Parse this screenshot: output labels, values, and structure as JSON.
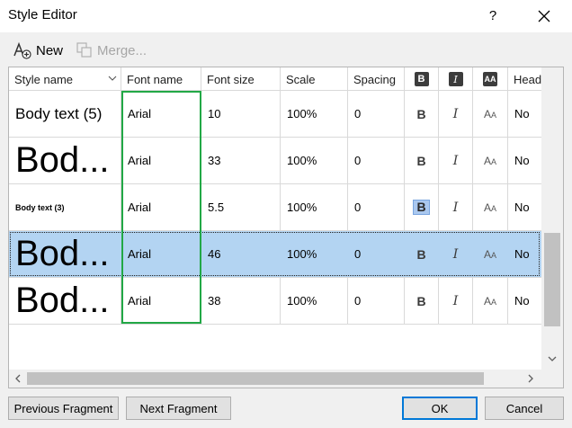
{
  "window": {
    "title": "Style Editor",
    "help_label": "?"
  },
  "toolbar": {
    "new_label": "New",
    "merge_label": "Merge..."
  },
  "grid": {
    "columns": {
      "style_name": "Style name",
      "font_name": "Font name",
      "font_size": "Font size",
      "scale": "Scale",
      "spacing": "Spacing",
      "heading": "Headi"
    },
    "header_icons": {
      "bold": "B",
      "italic": "I",
      "caps": "AA"
    },
    "glyphs": {
      "bold": "B",
      "italic": "I",
      "caps_big": "A",
      "caps_small": "A"
    },
    "rows": [
      {
        "style_name": "Body text (5)",
        "font_name": "Arial",
        "font_size": "10",
        "scale": "100%",
        "spacing": "0",
        "heading": "No",
        "bold_active": false,
        "selected": false
      },
      {
        "style_name": "Bod...",
        "font_name": "Arial",
        "font_size": "33",
        "scale": "100%",
        "spacing": "0",
        "heading": "No",
        "bold_active": false,
        "selected": false
      },
      {
        "style_name": "Body text (3)",
        "font_name": "Arial",
        "font_size": "5.5",
        "scale": "100%",
        "spacing": "0",
        "heading": "No",
        "bold_active": true,
        "selected": false
      },
      {
        "style_name": "Bod...",
        "font_name": "Arial",
        "font_size": "46",
        "scale": "100%",
        "spacing": "0",
        "heading": "No",
        "bold_active": false,
        "selected": true
      },
      {
        "style_name": "Bod...",
        "font_name": "Arial",
        "font_size": "38",
        "scale": "100%",
        "spacing": "0",
        "heading": "No",
        "bold_active": false,
        "selected": false
      }
    ]
  },
  "buttons": {
    "previous_fragment": "Previous Fragment",
    "next_fragment": "Next Fragment",
    "ok": "OK",
    "cancel": "Cancel"
  },
  "colors": {
    "selection": "#b3d4f2",
    "highlight_box": "#22a846",
    "primary_border": "#0078d7"
  }
}
